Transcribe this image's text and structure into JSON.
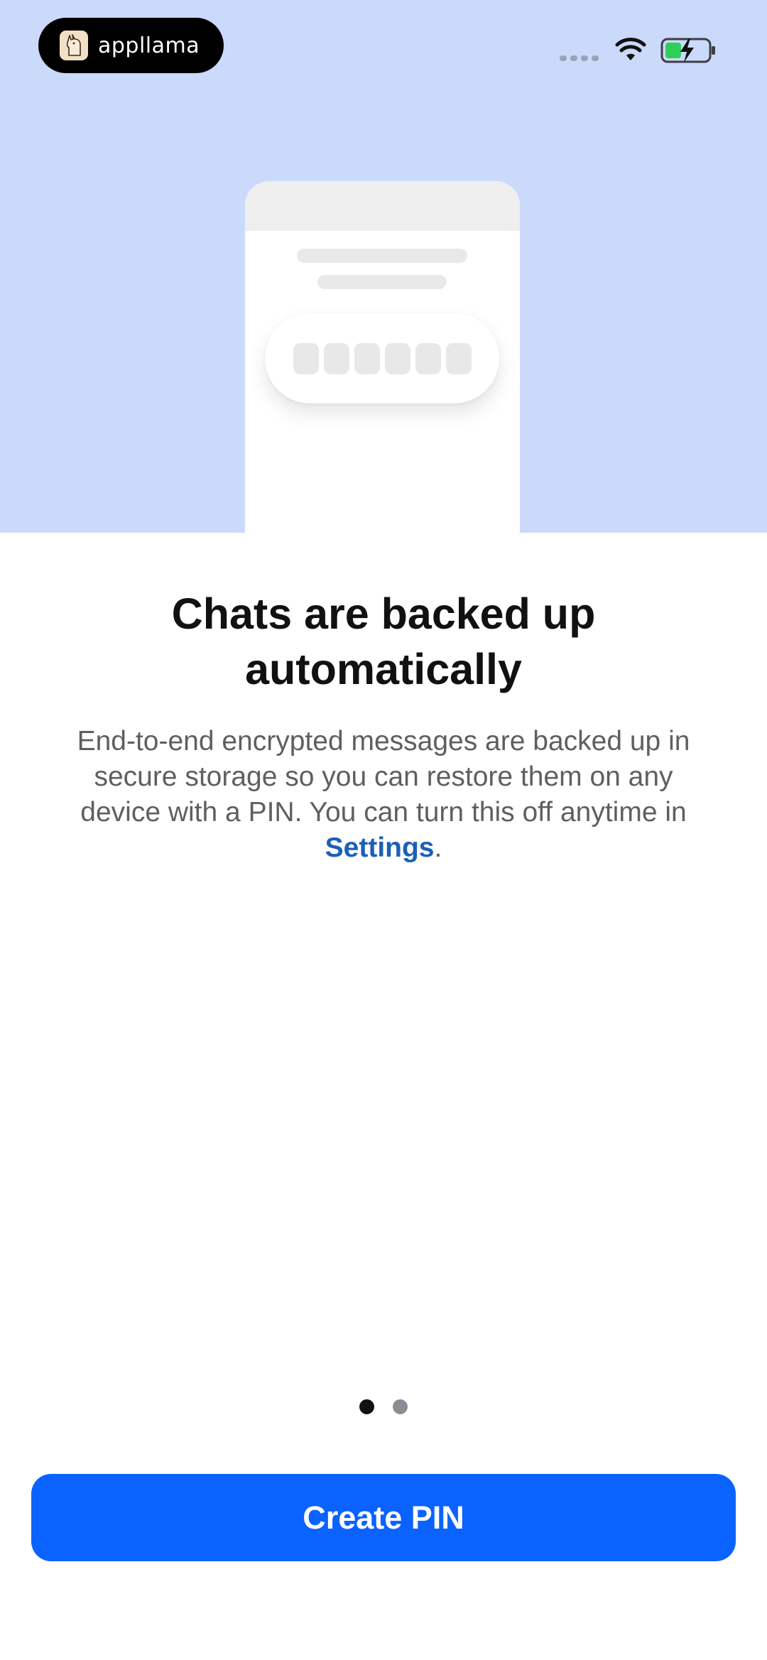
{
  "status_bar": {
    "app_name": "appllama",
    "wifi_icon": "wifi-icon",
    "battery_icon": "battery-charging-icon",
    "accent": "#2fcf5a"
  },
  "illustration": {
    "pin_placeholder_count": 6,
    "background": "#cbdafa"
  },
  "content": {
    "title": "Chats are backed up automatically",
    "body_prefix": "End-to-end encrypted messages are backed up in secure storage so you can restore them on any device with a PIN. You can turn this off anytime in ",
    "settings_link": "Settings",
    "body_suffix": ".",
    "link_color": "#1b5fb8"
  },
  "pager": {
    "current_page": 1,
    "total_pages": 2
  },
  "actions": {
    "primary_label": "Create PIN",
    "primary_color": "#0a63ff"
  }
}
